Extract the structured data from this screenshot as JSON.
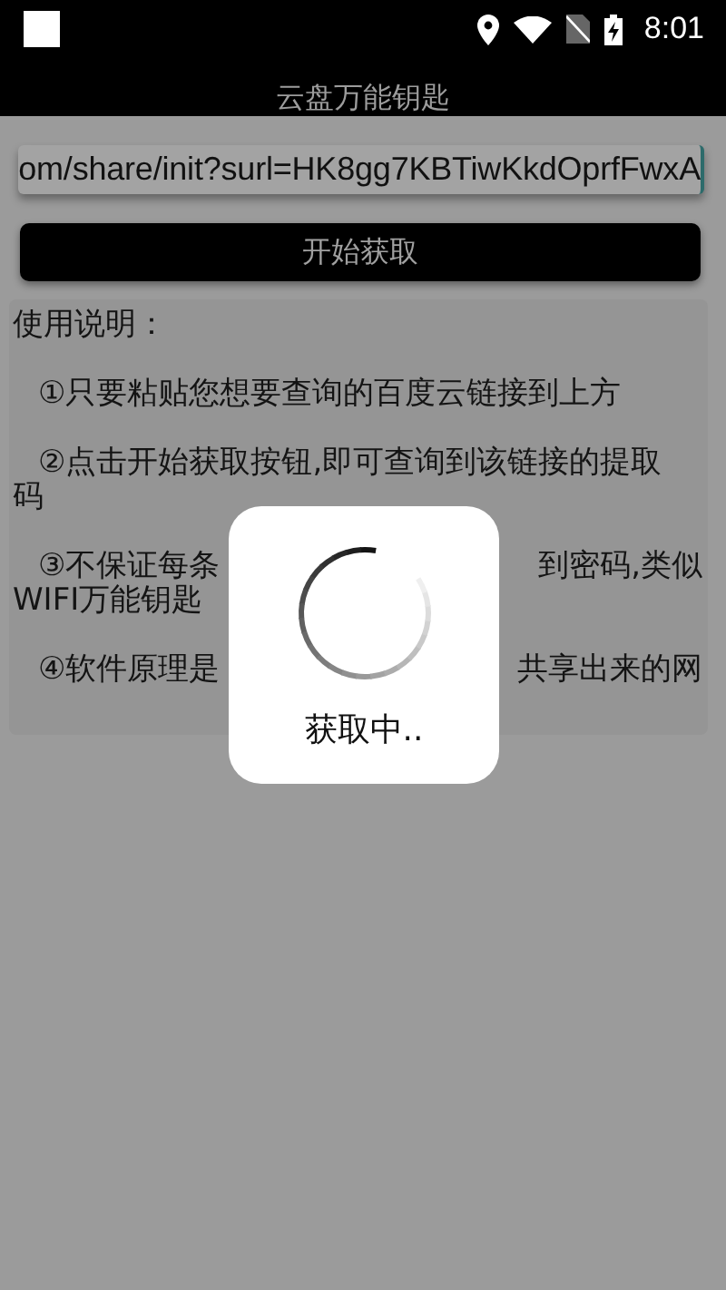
{
  "status_bar": {
    "time": "8:01"
  },
  "title": "云盘万能钥匙",
  "url_field": {
    "value": "om/share/init?surl=HK8gg7KBTiwKkdOprfFwxA"
  },
  "fetch_button": {
    "label": "开始获取"
  },
  "instructions": {
    "heading": "使用说明：",
    "items": [
      {
        "kind": "full",
        "text": "①只要粘贴您想要查询的百度云链接到上方"
      },
      {
        "kind": "full",
        "text": "②点击开始获取按钮,即可查询到该链接的提取码"
      },
      {
        "kind": "covered",
        "parts": [
          "③不保证每条",
          "到密码,类似"
        ],
        "continuation": "WIFI万能钥匙"
      },
      {
        "kind": "covered",
        "parts": [
          "④软件原理是",
          "共享出来的网"
        ]
      }
    ]
  },
  "dialog": {
    "message": "获取中.."
  }
}
